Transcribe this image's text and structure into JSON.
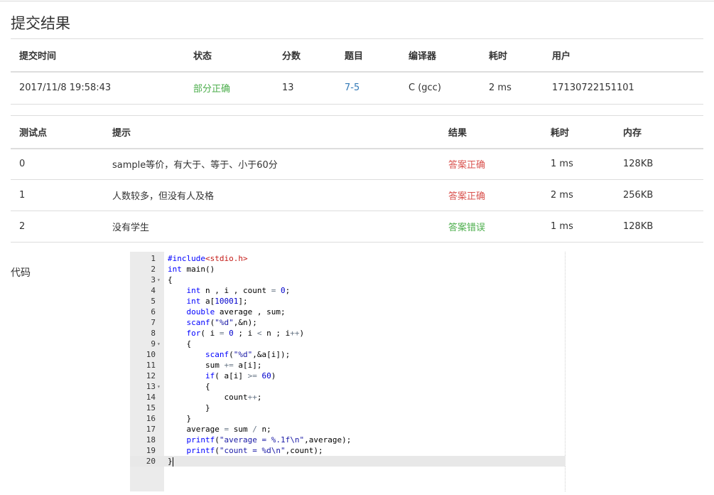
{
  "page": {
    "title": "提交结果"
  },
  "submission": {
    "headers": [
      "提交时间",
      "状态",
      "分数",
      "题目",
      "编译器",
      "耗时",
      "用户"
    ],
    "row": {
      "time": "2017/11/8 19:58:43",
      "status": "部分正确",
      "score": "13",
      "problem": "7-5",
      "compiler": "C (gcc)",
      "duration": "2 ms",
      "user": "17130722151101"
    }
  },
  "tests": {
    "headers": [
      "测试点",
      "提示",
      "结果",
      "耗时",
      "内存"
    ],
    "rows": [
      {
        "id": "0",
        "hint": "sample等价，有大于、等于、小于60分",
        "result": "答案正确",
        "time": "1 ms",
        "memory": "128KB"
      },
      {
        "id": "1",
        "hint": "人数较多，但没有人及格",
        "result": "答案正确",
        "time": "2 ms",
        "memory": "256KB"
      },
      {
        "id": "2",
        "hint": "没有学生",
        "result": "答案错误",
        "time": "1 ms",
        "memory": "128KB"
      }
    ]
  },
  "code": {
    "label": "代码",
    "lines": [
      "#include<stdio.h>",
      "int main()",
      "{",
      "    int n , i , count = 0;",
      "    int a[10001];",
      "    double average , sum;",
      "    scanf(\"%d\",&n);",
      "    for( i = 0 ; i < n ; i++)",
      "    {",
      "        scanf(\"%d\",&a[i]);",
      "        sum += a[i];",
      "        if( a[i] >= 60)",
      "        {",
      "            count++;",
      "        }",
      "    }",
      "    average = sum / n;",
      "    printf(\"average = %.1f\\n\",average);",
      "    printf(\"count = %d\\n\",count);",
      "}"
    ],
    "line_numbers": [
      "1",
      "2",
      "3",
      "4",
      "5",
      "6",
      "7",
      "8",
      "9",
      "10",
      "11",
      "12",
      "13",
      "14",
      "15",
      "16",
      "17",
      "18",
      "19",
      "20"
    ],
    "fold_lines": [
      3,
      9,
      13
    ],
    "active_line": 20
  },
  "colors": {
    "status_partial": "#4cae4c",
    "result_correct": "#d9534f",
    "result_wrong": "#4cae4c",
    "link": "#337ab7"
  }
}
